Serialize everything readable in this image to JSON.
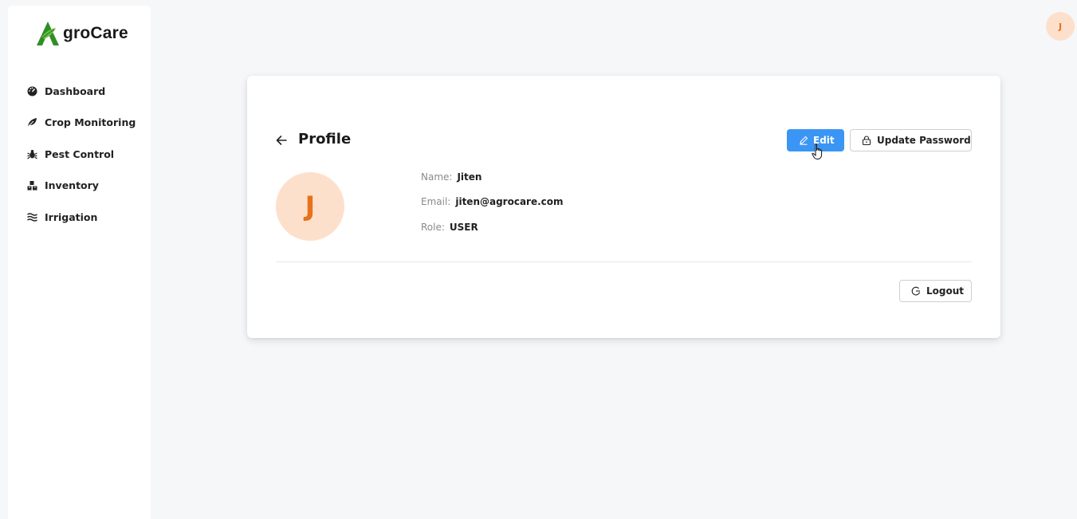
{
  "app": {
    "logo_text": "groCare",
    "logo_icon": "leaf-A-logo"
  },
  "sidebar": {
    "items": [
      {
        "label": "Dashboard",
        "icon": "dashboard-gauge-icon"
      },
      {
        "label": "Crop Monitoring",
        "icon": "leaf-icon"
      },
      {
        "label": "Pest Control",
        "icon": "bug-icon"
      },
      {
        "label": "Inventory",
        "icon": "boxes-icon"
      },
      {
        "label": "Irrigation",
        "icon": "water-waves-icon"
      }
    ]
  },
  "header": {
    "avatar_initial": "J"
  },
  "profile": {
    "title": "Profile",
    "edit_label": "Edit",
    "update_password_label": "Update Password",
    "logout_label": "Logout",
    "avatar_initial": "J",
    "name_label": "Name:",
    "name_value": "Jiten",
    "email_label": "Email:",
    "email_value": "jiten@agrocare.com",
    "role_label": "Role:",
    "role_value": "USER"
  },
  "colors": {
    "primary": "#3b95f4",
    "avatar_bg": "#fde0cc",
    "avatar_text": "#e8711c",
    "logo_green": "#3a9a2b",
    "background": "#f6f7f9"
  }
}
